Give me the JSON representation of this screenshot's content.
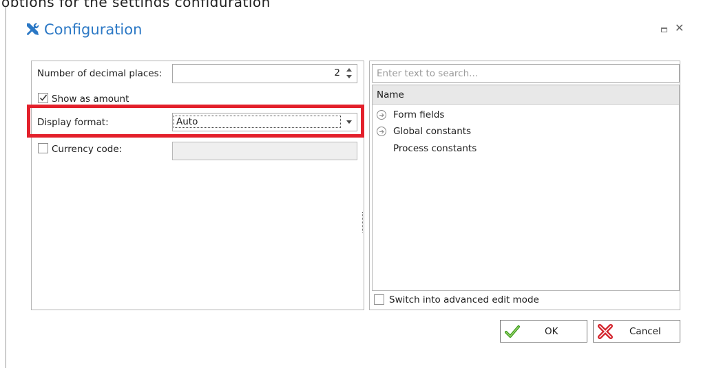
{
  "top_fragment": "options for the settings configuration",
  "dialog": {
    "title": "Configuration"
  },
  "left_panel": {
    "decimal_places_label": "Number of decimal places:",
    "decimal_places_value": "2",
    "show_as_amount_label": "Show as amount",
    "show_as_amount_checked": true,
    "display_format_label": "Display format:",
    "display_format_value": "Auto",
    "currency_code_label": "Currency code:",
    "currency_code_checked": false,
    "currency_code_value": ""
  },
  "right_panel": {
    "search_placeholder": "Enter text to search...",
    "column_header": "Name",
    "tree_items": [
      {
        "label": "Form fields",
        "expandable": true
      },
      {
        "label": "Global constants",
        "expandable": true
      },
      {
        "label": "Process constants",
        "expandable": false
      }
    ],
    "advanced_mode_label": "Switch into advanced edit mode",
    "advanced_mode_checked": false
  },
  "buttons": {
    "ok_label": "OK",
    "cancel_label": "Cancel"
  },
  "colors": {
    "title": "#2b78c5",
    "highlight": "#e3202b",
    "ok_icon": "#3a9a1e",
    "cancel_icon": "#d3212a"
  },
  "icons": {
    "title": "tools-icon",
    "ok": "checkmark-icon",
    "cancel": "cross-icon",
    "expander": "circle-arrow-right-icon"
  }
}
